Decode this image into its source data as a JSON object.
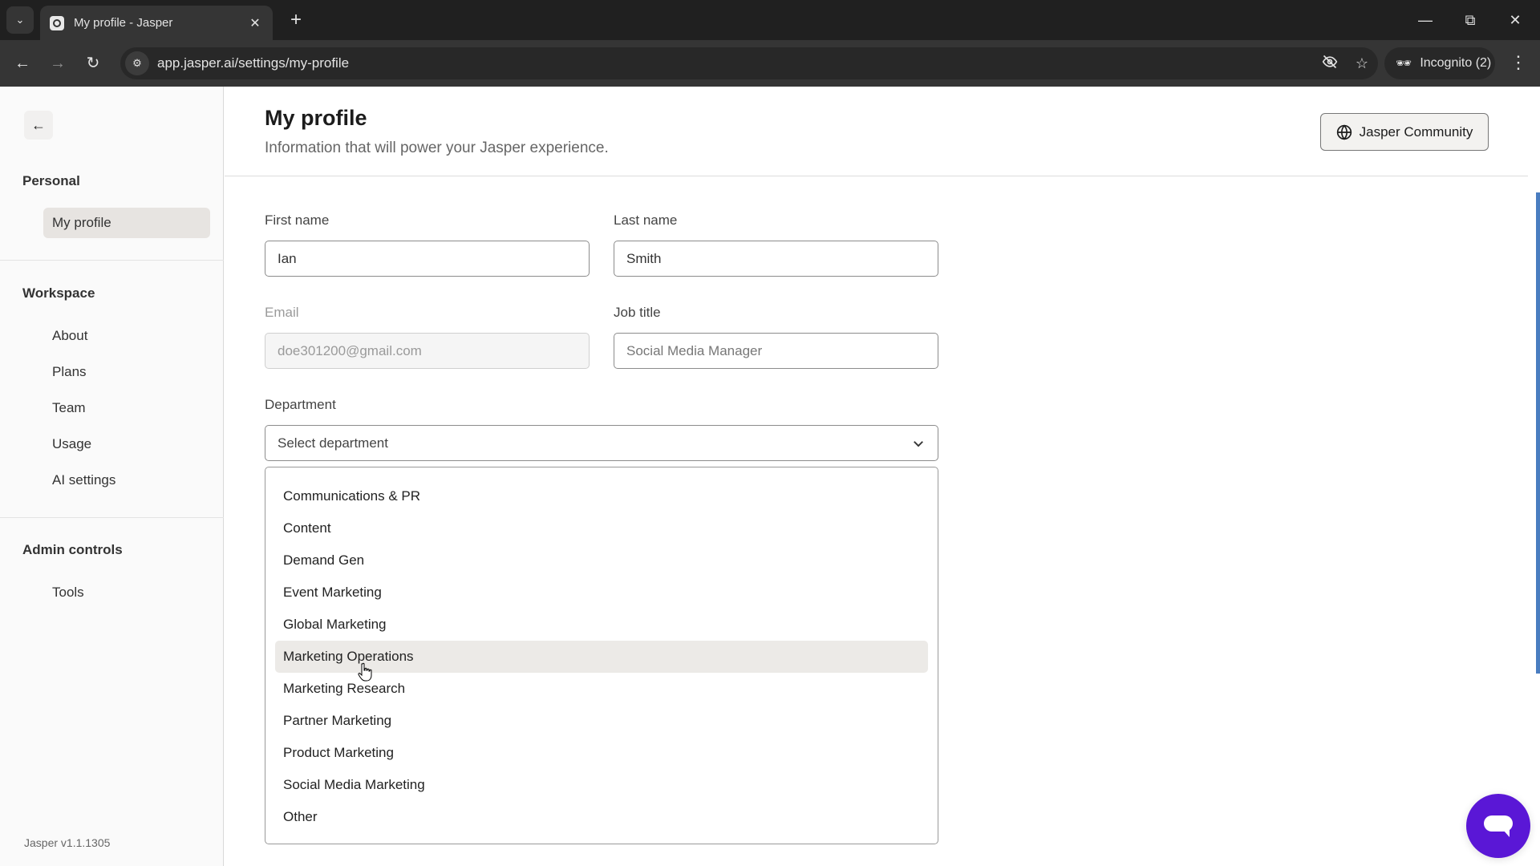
{
  "browser": {
    "tab_title": "My profile - Jasper",
    "url": "app.jasper.ai/settings/my-profile",
    "incognito_label": "Incognito (2)",
    "icons": {
      "tab_search": "chevron-down-icon",
      "favicon": "jasper-logo-icon",
      "close_tab": "close-icon",
      "new_tab": "plus-icon",
      "back": "arrow-left-icon",
      "forward": "arrow-right-icon",
      "reload": "reload-icon",
      "site_info": "tune-icon",
      "tracking": "eye-off-icon",
      "bookmark": "star-icon",
      "incognito": "incognito-icon",
      "menu": "more-vert-icon",
      "minimize": "minimize-icon",
      "restore": "restore-icon",
      "close_window": "close-icon"
    }
  },
  "sidebar": {
    "back_icon": "arrow-left-icon",
    "sections": [
      {
        "title": "Personal",
        "items": [
          {
            "label": "My profile",
            "active": true
          }
        ]
      },
      {
        "title": "Workspace",
        "items": [
          {
            "label": "About"
          },
          {
            "label": "Plans"
          },
          {
            "label": "Team"
          },
          {
            "label": "Usage"
          },
          {
            "label": "AI settings"
          }
        ]
      },
      {
        "title": "Admin controls",
        "items": [
          {
            "label": "Tools"
          }
        ]
      }
    ],
    "version": "Jasper v1.1.1305"
  },
  "header": {
    "title": "My profile",
    "subtitle": "Information that will power your Jasper experience.",
    "community_button": "Jasper Community",
    "community_icon": "globe-icon"
  },
  "form": {
    "first_name": {
      "label": "First name",
      "value": "Ian"
    },
    "last_name": {
      "label": "Last name",
      "value": "Smith"
    },
    "email": {
      "label": "Email",
      "value": "doe301200@gmail.com",
      "disabled": true
    },
    "job_title": {
      "label": "Job title",
      "placeholder": "Social Media Manager",
      "value": ""
    },
    "department": {
      "label": "Department",
      "placeholder": "Select department",
      "hovered_option": "Marketing Operations",
      "options": [
        "Communications & PR",
        "Content",
        "Demand Gen",
        "Event Marketing",
        "Global Marketing",
        "Marketing Operations",
        "Marketing Research",
        "Partner Marketing",
        "Product Marketing",
        "Social Media Marketing",
        "Other"
      ]
    }
  },
  "chat_widget": {
    "icon": "chat-bubble-icon",
    "color": "#5a17d6"
  },
  "colors": {
    "accent": "#5a17d6",
    "scrollbar": "#4a7dc0",
    "active_nav": "#e7e4e1",
    "hover_option": "#eceae7"
  }
}
